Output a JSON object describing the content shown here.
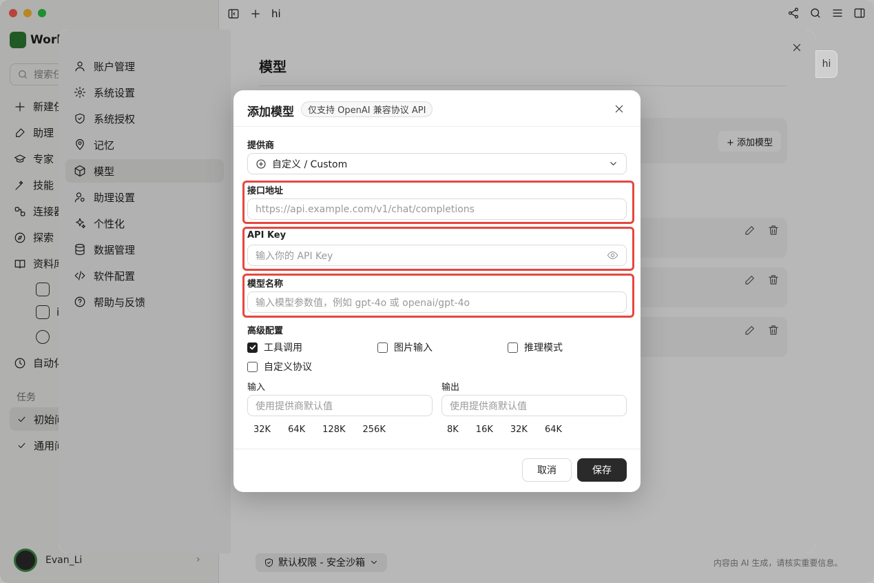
{
  "window": {
    "tab_title": "hi"
  },
  "sidebar": {
    "brand": "Work",
    "search_placeholder": "搜索任",
    "nav": [
      {
        "label": "新建任",
        "icon": "plus-icon"
      },
      {
        "label": "助理",
        "icon": "brush-icon"
      },
      {
        "label": "专家",
        "icon": "graduation-cap-icon"
      },
      {
        "label": "技能",
        "icon": "magic-wand-icon"
      },
      {
        "label": "连接器",
        "icon": "connector-icon"
      },
      {
        "label": "探索",
        "icon": "compass-icon"
      },
      {
        "label": "资料库",
        "icon": "book-icon"
      },
      {
        "label": "自动化",
        "icon": "clock-icon"
      }
    ],
    "library_items": [
      "i"
    ],
    "tasks_heading": "任务",
    "tasks": [
      {
        "label": "初始问"
      },
      {
        "label": "通用问"
      }
    ],
    "user_name": "Evan_Li"
  },
  "bottom": {
    "permission_label": "默认权限 - 安全沙箱",
    "disclaimer": "内容由 AI 生成，请核实重要信息。"
  },
  "settings": {
    "nav": [
      {
        "label": "账户管理",
        "icon": "user-icon"
      },
      {
        "label": "系统设置",
        "icon": "gear-icon"
      },
      {
        "label": "系统授权",
        "icon": "shield-icon"
      },
      {
        "label": "记忆",
        "icon": "map-pin-icon"
      },
      {
        "label": "模型",
        "icon": "cube-icon",
        "active": true
      },
      {
        "label": "助理设置",
        "icon": "user-gear-icon"
      },
      {
        "label": "个性化",
        "icon": "sparkles-icon"
      },
      {
        "label": "数据管理",
        "icon": "database-icon"
      },
      {
        "label": "软件配置",
        "icon": "code-icon"
      },
      {
        "label": "帮助与反馈",
        "icon": "help-circle-icon"
      }
    ],
    "title": "模型",
    "add_model_label": "+ 添加模型",
    "peek_text": "hi"
  },
  "modal": {
    "title": "添加模型",
    "badge": "仅支持 OpenAI 兼容协议 API",
    "provider": {
      "label": "提供商",
      "value": "自定义 / Custom"
    },
    "endpoint": {
      "label": "接口地址",
      "placeholder": "https://api.example.com/v1/chat/completions"
    },
    "api_key": {
      "label": "API Key",
      "placeholder": "输入你的 API Key"
    },
    "model_name": {
      "label": "模型名称",
      "placeholder": "输入模型参数值，例如 gpt-4o 或 openai/gpt-4o"
    },
    "advanced": {
      "label": "高级配置",
      "options": [
        {
          "label": "工具调用",
          "checked": true
        },
        {
          "label": "图片输入",
          "checked": false
        },
        {
          "label": "推理模式",
          "checked": false
        },
        {
          "label": "自定义协议",
          "checked": false
        }
      ]
    },
    "input": {
      "label": "输入",
      "placeholder": "使用提供商默认值",
      "presets": [
        "32K",
        "64K",
        "128K",
        "256K"
      ]
    },
    "output": {
      "label": "输出",
      "placeholder": "使用提供商默认值",
      "presets": [
        "8K",
        "16K",
        "32K",
        "64K"
      ]
    },
    "cancel_label": "取消",
    "save_label": "保存"
  },
  "colors": {
    "highlight_border": "#e5473f",
    "primary_button": "#2a2a2a",
    "brand_green": "#2e7d32"
  }
}
